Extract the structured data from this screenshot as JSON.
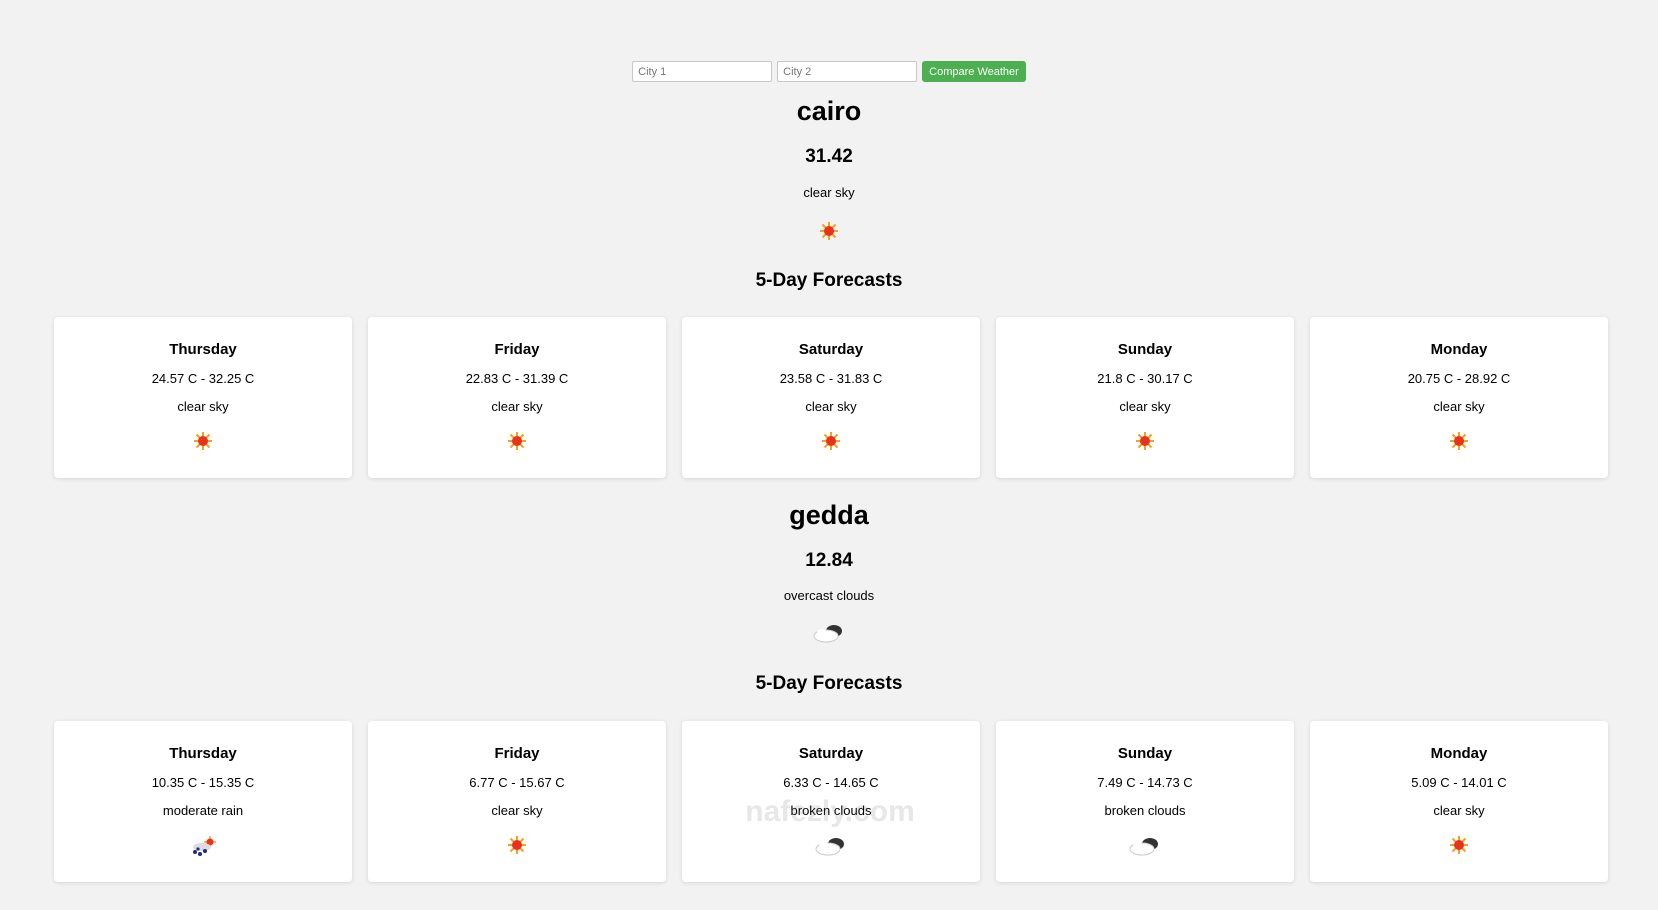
{
  "search": {
    "city1_placeholder": "City 1",
    "city2_placeholder": "City 2",
    "compare_label": "Compare Weather",
    "button_color": "#4caf50"
  },
  "cities": [
    {
      "name": "cairo",
      "temp": "31.42",
      "description": "clear sky",
      "icon": "sun-icon",
      "forecast_heading": "5-Day Forecasts",
      "forecast": [
        {
          "day": "Thursday",
          "range": "24.57 C - 32.25 C",
          "description": "clear sky",
          "icon": "sun-icon"
        },
        {
          "day": "Friday",
          "range": "22.83 C - 31.39 C",
          "description": "clear sky",
          "icon": "sun-icon"
        },
        {
          "day": "Saturday",
          "range": "23.58 C - 31.83 C",
          "description": "clear sky",
          "icon": "sun-icon"
        },
        {
          "day": "Sunday",
          "range": "21.8 C - 30.17 C",
          "description": "clear sky",
          "icon": "sun-icon"
        },
        {
          "day": "Monday",
          "range": "20.75 C - 28.92 C",
          "description": "clear sky",
          "icon": "sun-icon"
        }
      ]
    },
    {
      "name": "gedda",
      "temp": "12.84",
      "description": "overcast clouds",
      "icon": "overcast-clouds-icon",
      "forecast_heading": "5-Day Forecasts",
      "forecast": [
        {
          "day": "Thursday",
          "range": "10.35 C - 15.35 C",
          "description": "moderate rain",
          "icon": "rain-icon"
        },
        {
          "day": "Friday",
          "range": "6.77 C - 15.67 C",
          "description": "clear sky",
          "icon": "sun-icon"
        },
        {
          "day": "Saturday",
          "range": "6.33 C - 14.65 C",
          "description": "broken clouds",
          "icon": "broken-clouds-icon"
        },
        {
          "day": "Sunday",
          "range": "7.49 C - 14.73 C",
          "description": "broken clouds",
          "icon": "broken-clouds-icon"
        },
        {
          "day": "Monday",
          "range": "5.09 C - 14.01 C",
          "description": "clear sky",
          "icon": "sun-icon"
        }
      ]
    }
  ],
  "watermark": {
    "text": "nafezly.com"
  }
}
